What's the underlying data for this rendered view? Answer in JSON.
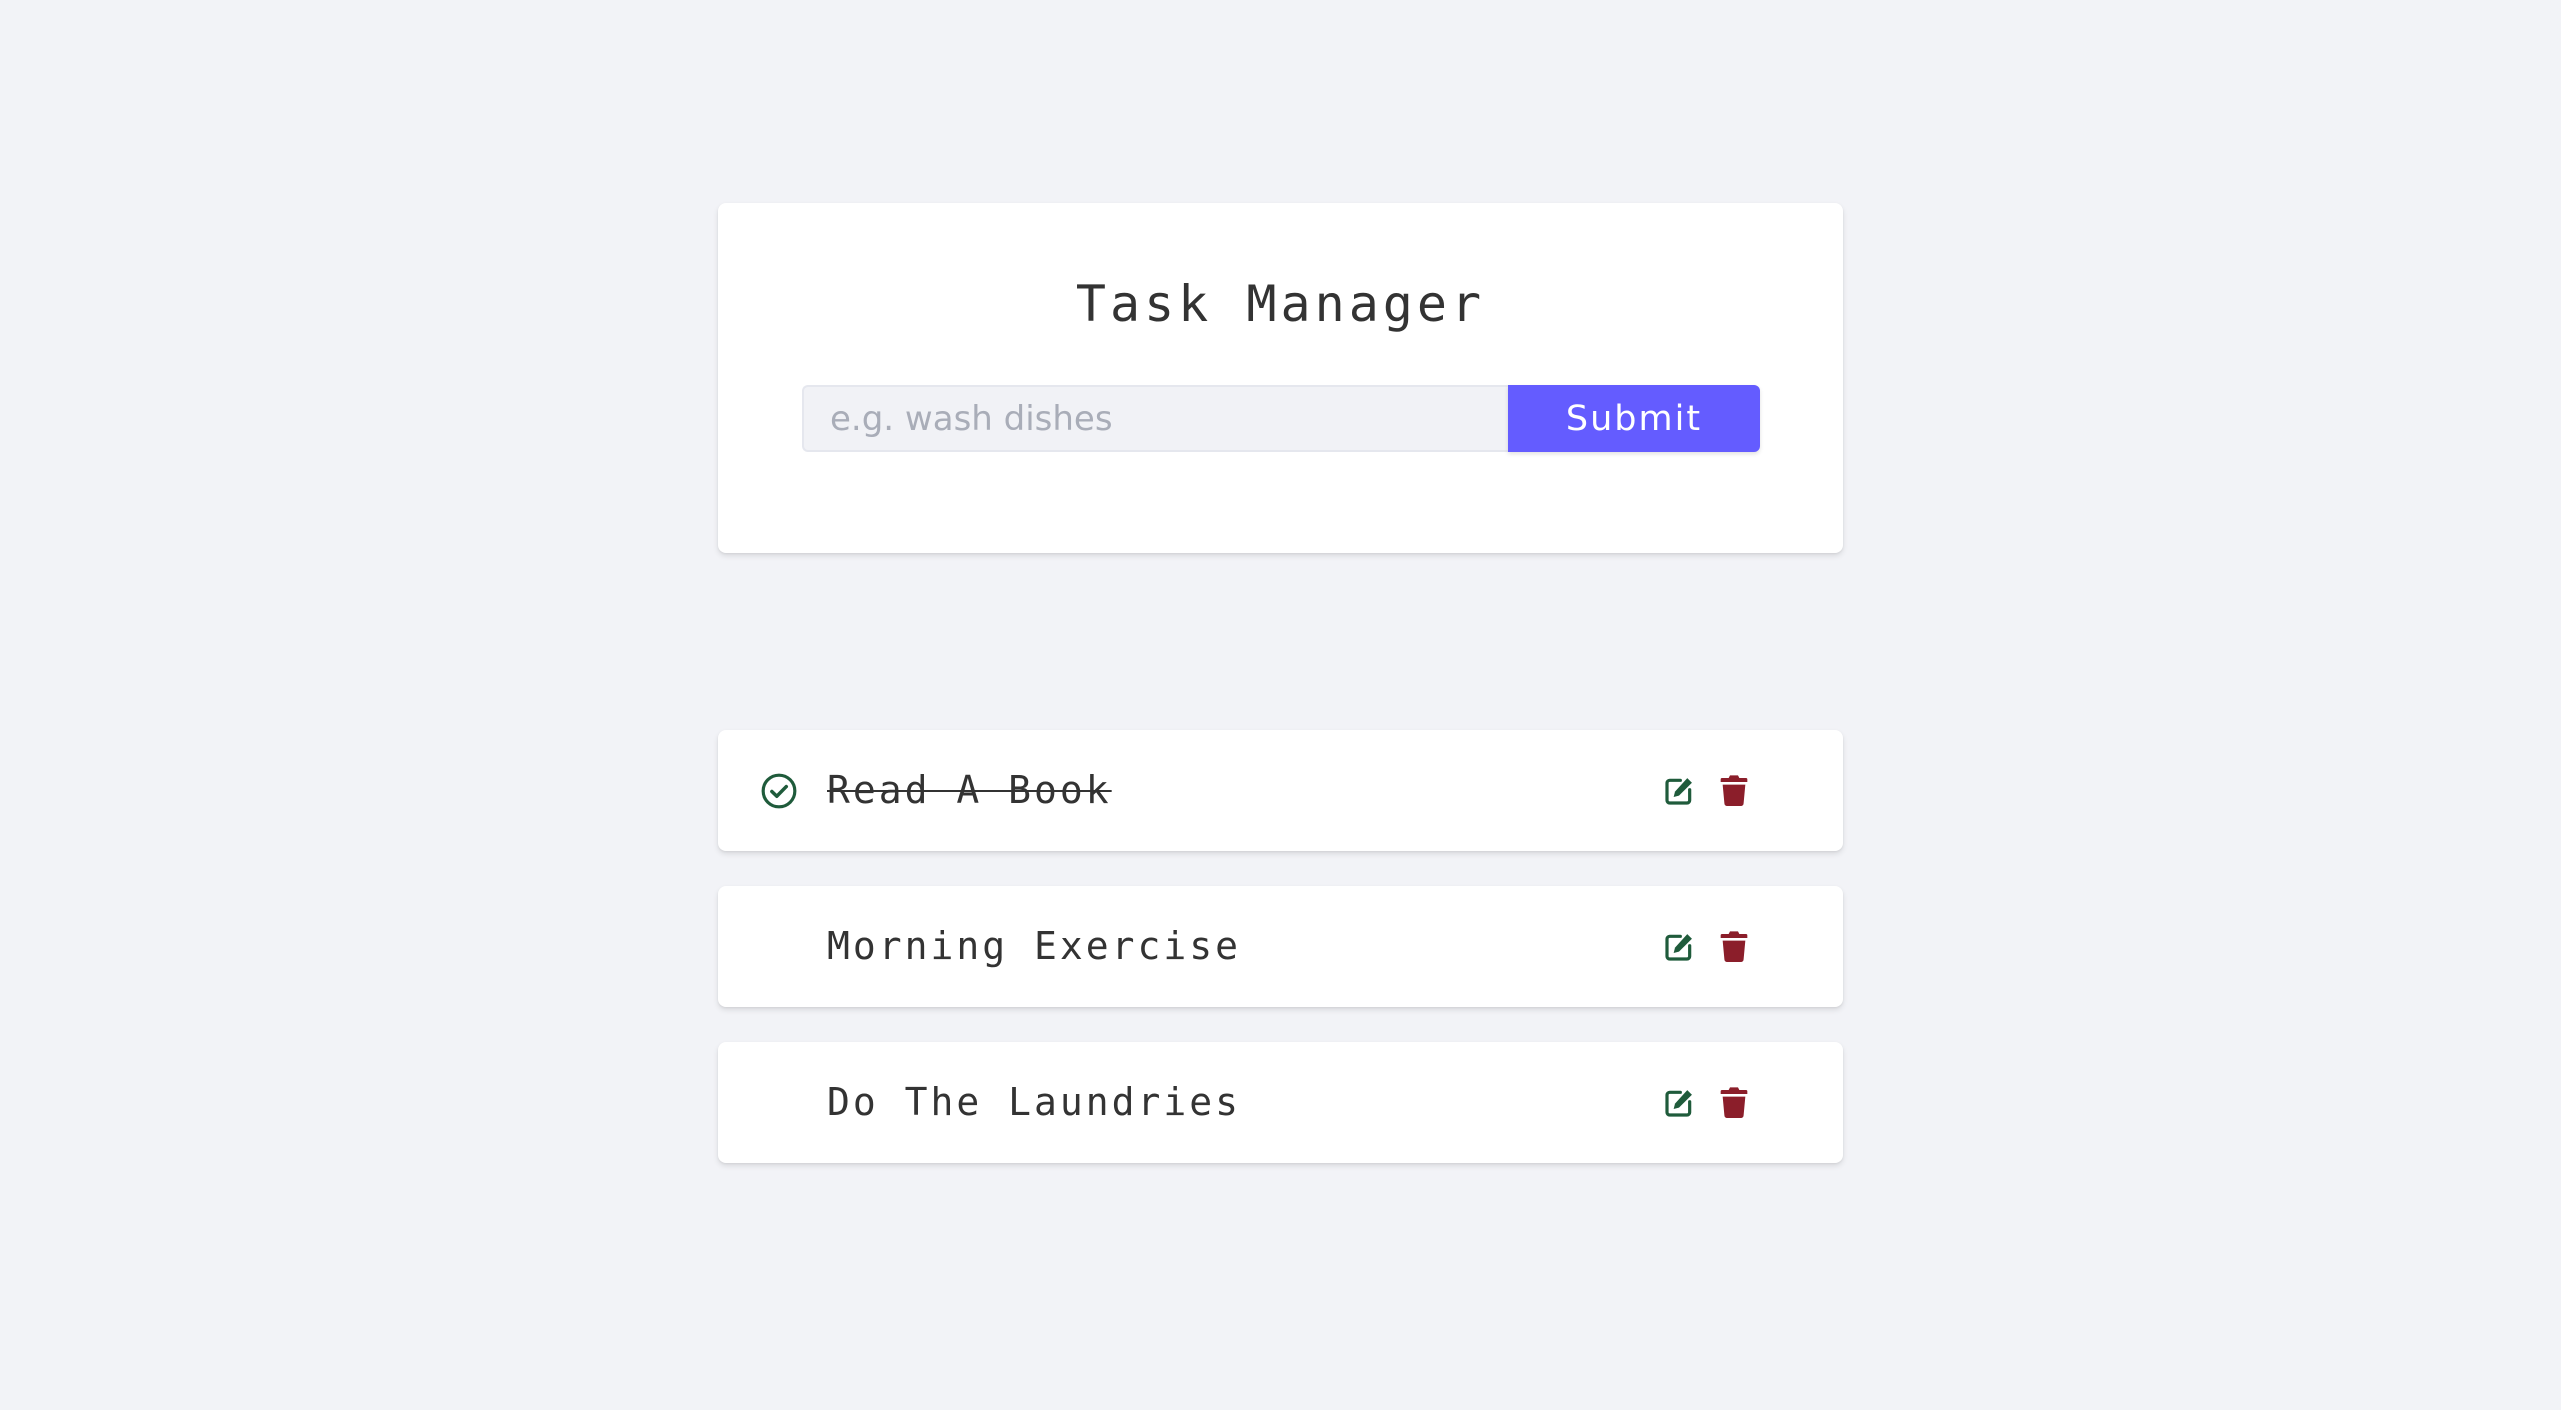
{
  "app": {
    "title": "Task Manager"
  },
  "form": {
    "input_placeholder": "e.g. wash dishes",
    "input_value": "",
    "submit_label": "Submit"
  },
  "colors": {
    "background": "#f2f3f7",
    "accent": "#645cff",
    "edit_icon": "#1f5b3b",
    "delete_icon": "#8b1e2a",
    "check_icon": "#1f5b3b"
  },
  "tasks": [
    {
      "name": "Read A Book",
      "completed": true,
      "icons": [
        "check-circle-icon",
        "edit-icon",
        "trash-icon"
      ]
    },
    {
      "name": "Morning Exercise",
      "completed": false,
      "icons": [
        "edit-icon",
        "trash-icon"
      ]
    },
    {
      "name": "Do The Laundries",
      "completed": false,
      "icons": [
        "edit-icon",
        "trash-icon"
      ]
    }
  ]
}
